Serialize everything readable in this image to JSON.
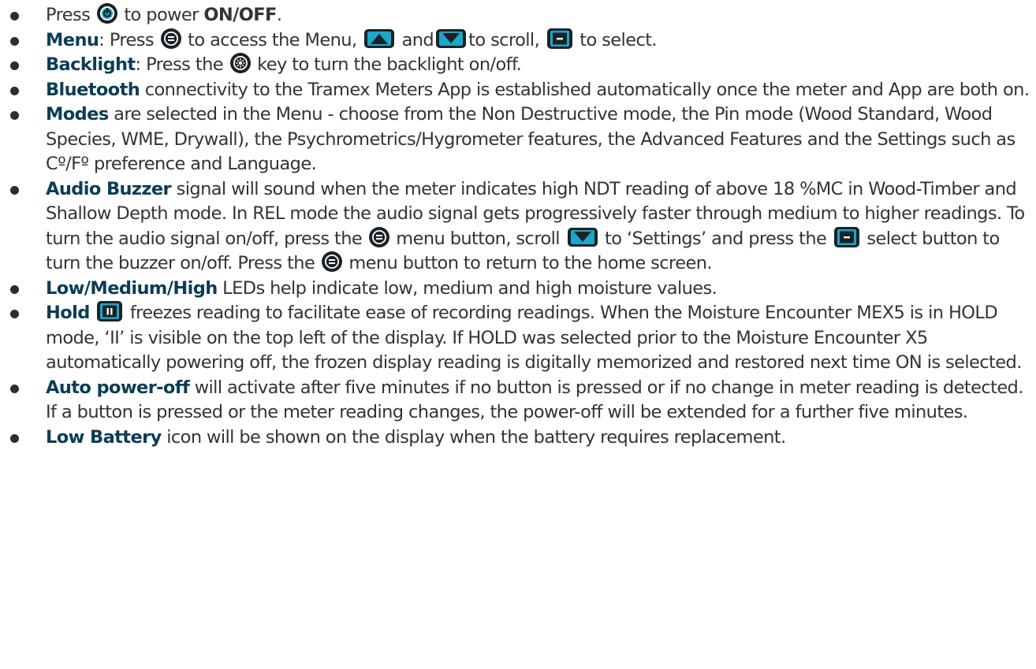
{
  "bullets": [
    {
      "parts": [
        {
          "t": "Press "
        },
        {
          "icon": "power-icon"
        },
        {
          "t": " to power "
        },
        {
          "t": "ON/OFF",
          "k": "strong"
        },
        {
          "t": "."
        }
      ]
    },
    {
      "parts": [
        {
          "t": "Menu",
          "k": "kw"
        },
        {
          "t": ": Press "
        },
        {
          "icon": "menu-icon"
        },
        {
          "t": " to access the Menu, "
        },
        {
          "icon": "up-arrow-icon"
        },
        {
          "t": " and"
        },
        {
          "icon": "down-arrow-icon"
        },
        {
          "t": "to scroll, "
        },
        {
          "icon": "select-icon"
        },
        {
          "t": " to select."
        }
      ]
    },
    {
      "parts": [
        {
          "t": "Backlight",
          "k": "kw"
        },
        {
          "t": ": Press the "
        },
        {
          "icon": "backlight-icon"
        },
        {
          "t": " key to turn the backlight on/off."
        }
      ]
    },
    {
      "parts": [
        {
          "t": "Bluetooth",
          "k": "kw"
        },
        {
          "t": " connectivity to the Tramex Meters App is established automatically once the meter and App are both on."
        }
      ]
    },
    {
      "parts": [
        {
          "t": "Modes",
          "k": "kw"
        },
        {
          "t": " are selected in the Menu - choose from the Non Destructive mode, the Pin mode (Wood Standard, Wood Species, WME, Drywall), the Psychrometrics/Hygrometer features, the Advanced Features and the Settings such as Cº/Fº preference and Language."
        }
      ]
    },
    {
      "parts": [
        {
          "t": "Audio Buzzer",
          "k": "kw"
        },
        {
          "t": " signal will sound when the meter indicates high NDT reading of above 18 %MC in Wood-Timber and Shallow Depth mode. In REL mode the audio signal gets progressively faster through medium to higher readings. To turn the audio signal on/off, press the "
        },
        {
          "icon": "menu-icon"
        },
        {
          "t": " menu button, scroll "
        },
        {
          "icon": "down-arrow-icon"
        },
        {
          "t": " to ‘Settings’ and press the "
        },
        {
          "icon": "select-icon"
        },
        {
          "t": " select button to turn the buzzer on/off. Press the "
        },
        {
          "icon": "menu-icon"
        },
        {
          "t": " menu button to return to the home screen."
        }
      ]
    },
    {
      "parts": [
        {
          "t": "Low/Medium/High",
          "k": "kw"
        },
        {
          "t": " LEDs help indicate low, medium and high moisture values."
        }
      ]
    },
    {
      "parts": [
        {
          "t": "Hold",
          "k": "kw"
        },
        {
          "t": " "
        },
        {
          "icon": "hold-icon"
        },
        {
          "t": " freezes reading to facilitate ease of recording readings. When the Moisture Encounter MEX5 is in HOLD mode, ‘II’ is visible on the top left of the display. If HOLD was selected prior to the Moisture Encounter X5 automatically powering off, the frozen display reading is digitally memorized and restored next time ON is selected."
        }
      ]
    },
    {
      "parts": [
        {
          "t": "Auto power-off",
          "k": "kw"
        },
        {
          "t": " will activate after five minutes if no button is pressed or if no change in meter reading is detected. If a button is pressed or the meter reading changes, the power-off will be extended for a further five minutes."
        }
      ]
    },
    {
      "parts": [
        {
          "t": "Low Battery",
          "k": "kw"
        },
        {
          "t": " icon will be shown on the display when the battery requires replacement."
        }
      ]
    }
  ],
  "colors": {
    "keyword": "#0b3d55",
    "text": "#333333",
    "icon_bg": "#1b2226",
    "icon_accent": "#1aa7c9"
  }
}
